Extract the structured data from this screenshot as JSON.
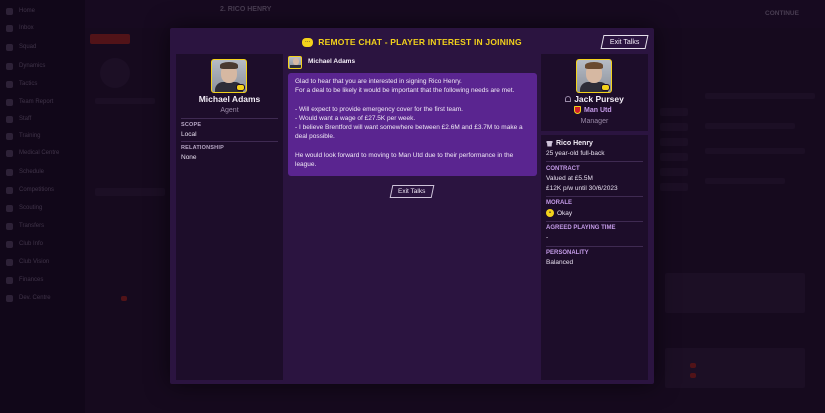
{
  "background": {
    "header_name": "2. RICO HENRY",
    "nav_items": [
      "Home",
      "Inbox",
      "Squad",
      "Dynamics",
      "Tactics",
      "Team Report",
      "Staff",
      "Training",
      "Medical Centre",
      "Schedule",
      "Competitions",
      "Scouting",
      "Transfers",
      "Club Info",
      "Club Vision",
      "Finances",
      "Dev. Centre"
    ],
    "continue_label": "CONTINUE"
  },
  "modal": {
    "title": "REMOTE CHAT - PLAYER INTEREST IN JOINING",
    "exit_top_label": "Exit Talks",
    "exit_mid_label": "Exit Talks"
  },
  "agent": {
    "name": "Michael Adams",
    "role": "Agent",
    "scope_label": "SCOPE",
    "scope_value": "Local",
    "relationship_label": "RELATIONSHIP",
    "relationship_value": "None"
  },
  "chat": {
    "sender": "Michael Adams",
    "message": "Glad to hear that you are interested in signing Rico Henry.\nFor a deal to be likely it would be important that the following needs are met.\n\n- Will expect to provide emergency cover for the first team.\n- Would want a wage of £27.5K per week.\n- I believe Brentford will want somewhere between £2.6M and £3.7M to make a deal possible.\n\nHe would look forward to moving to Man Utd due to their performance in the league."
  },
  "manager": {
    "name": "Jack Pursey",
    "club": "Man Utd",
    "role": "Manager"
  },
  "player": {
    "name": "Rico Henry",
    "description": "25 year-old full-back",
    "contract_label": "CONTRACT",
    "contract_value": "Valued at £5.5M",
    "contract_wage": "£12K p/w until 30/6/2023",
    "morale_label": "MORALE",
    "morale_value": "Okay",
    "playing_time_label": "AGREED PLAYING TIME",
    "playing_time_value": "-",
    "personality_label": "PERSONALITY",
    "personality_value": "Balanced"
  },
  "colors": {
    "accent_yellow": "#f3d21b",
    "bubble_purple": "#5a2590",
    "label_lilac": "#c49be8"
  }
}
